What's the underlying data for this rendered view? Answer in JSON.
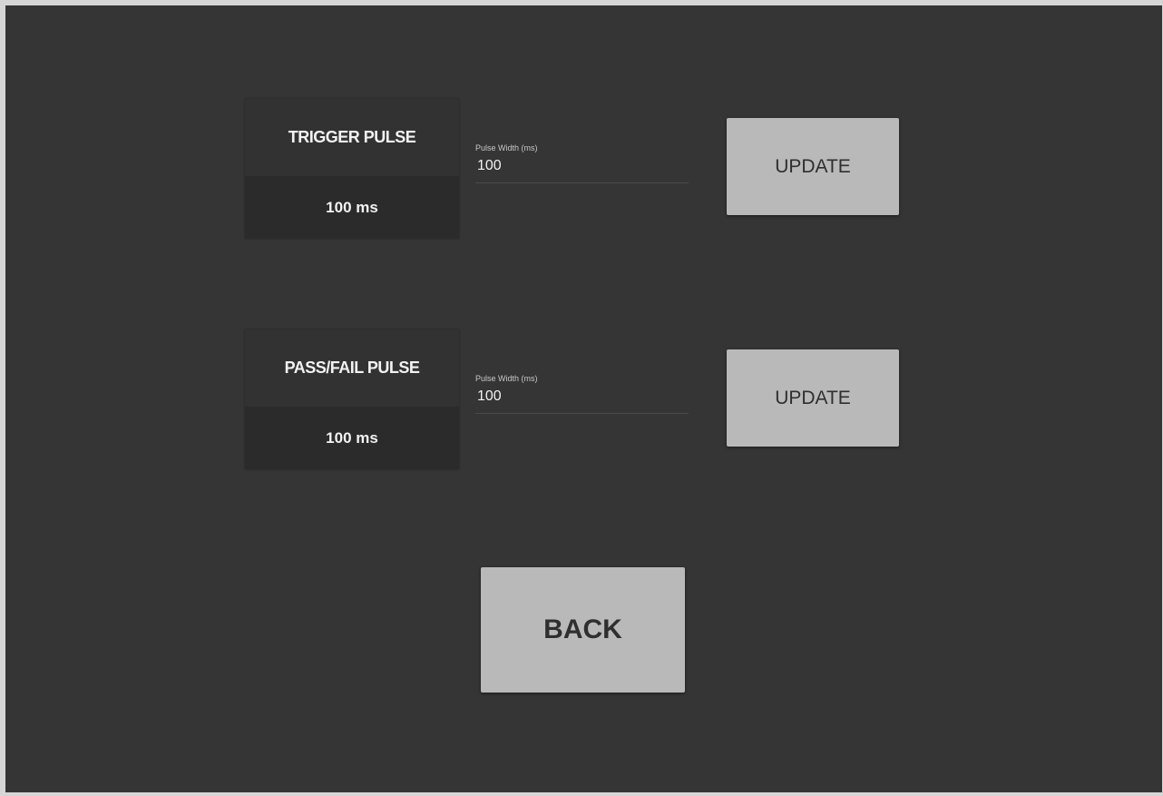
{
  "trigger": {
    "title": "TRIGGER PULSE",
    "current_value": "100 ms",
    "field_label": "Pulse Width (ms)",
    "field_value": "100",
    "update_label": "UPDATE"
  },
  "passfail": {
    "title": "PASS/FAIL PULSE",
    "current_value": "100 ms",
    "field_label": "Pulse Width (ms)",
    "field_value": "100",
    "update_label": "UPDATE"
  },
  "navigation": {
    "back_label": "BACK"
  },
  "colors": {
    "background": "#353535",
    "card": "#2b2b2b",
    "button": "#b9b9b9",
    "button_text": "#2f2f2f",
    "text": "#f2f2f2"
  }
}
